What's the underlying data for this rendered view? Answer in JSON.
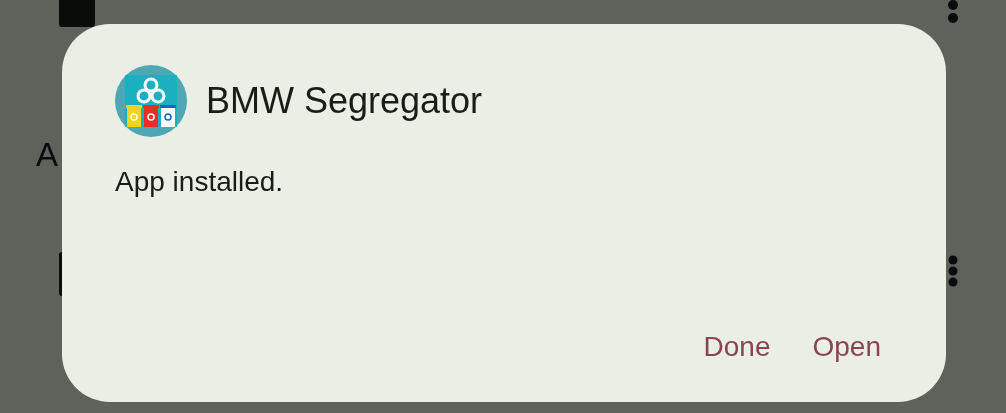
{
  "background": {
    "section_heading": "A"
  },
  "dialog": {
    "app_name": "BMW Segregator",
    "message": "App installed.",
    "buttons": [
      {
        "label": "Done"
      },
      {
        "label": "Open"
      }
    ]
  }
}
